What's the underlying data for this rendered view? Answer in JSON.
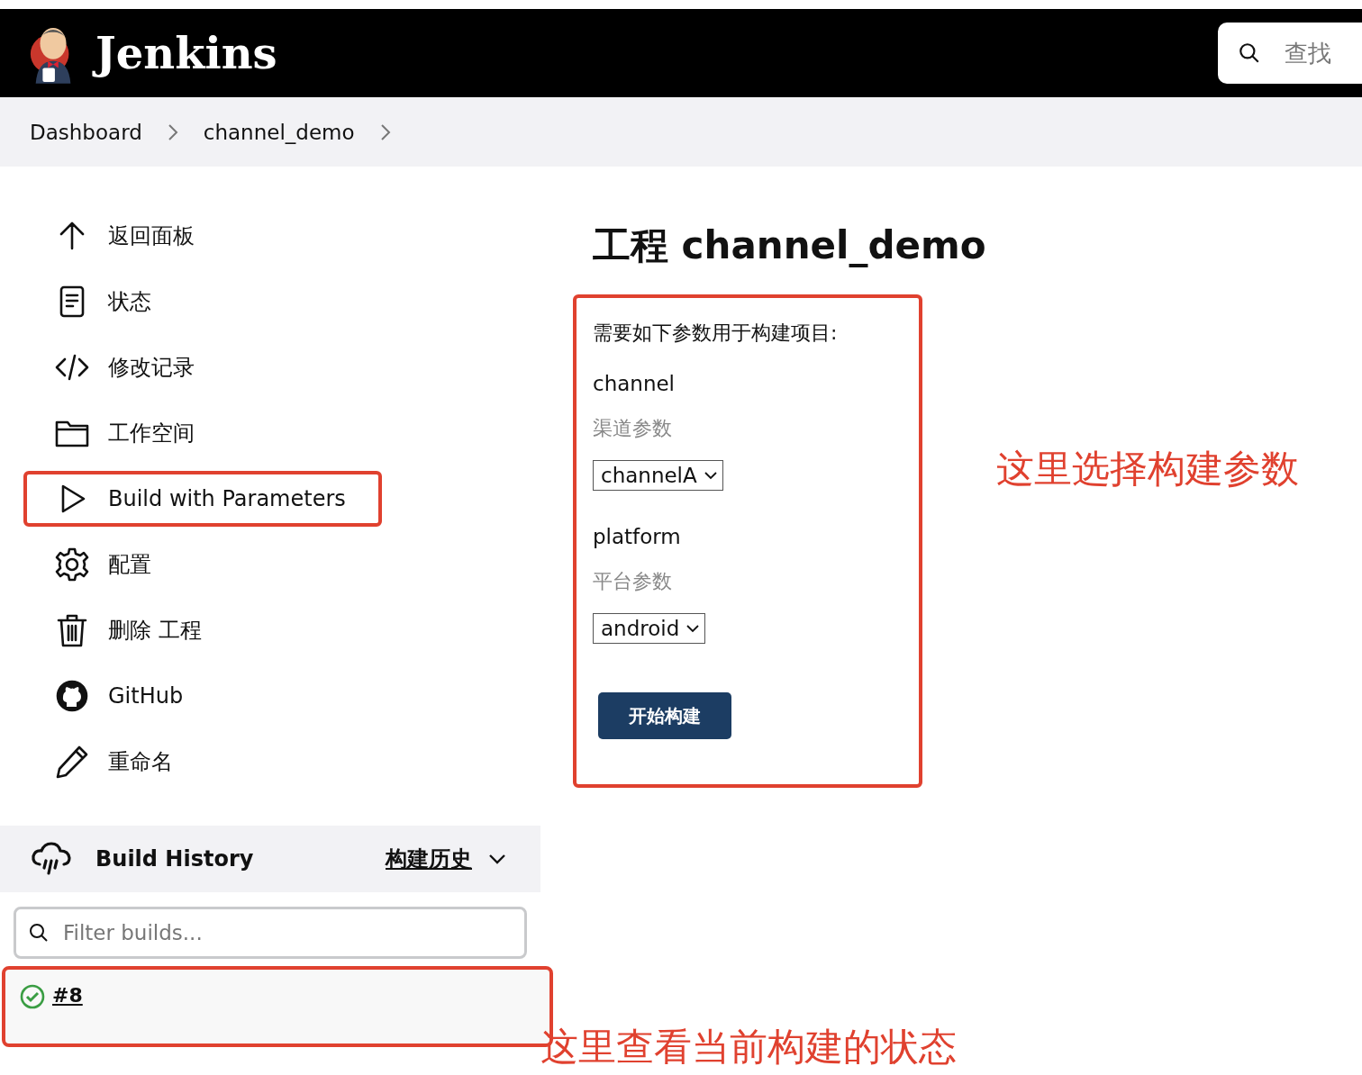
{
  "header": {
    "brand": "Jenkins",
    "search": {
      "placeholder": "查找"
    }
  },
  "breadcrumbs": [
    {
      "label": "Dashboard"
    },
    {
      "label": "channel_demo"
    }
  ],
  "sidebar": {
    "items": [
      {
        "label": "返回面板",
        "highlighted": false
      },
      {
        "label": "状态",
        "highlighted": false
      },
      {
        "label": "修改记录",
        "highlighted": false
      },
      {
        "label": "工作空间",
        "highlighted": false
      },
      {
        "label": "Build with Parameters",
        "highlighted": true
      },
      {
        "label": "配置",
        "highlighted": false
      },
      {
        "label": "删除 工程",
        "highlighted": false
      },
      {
        "label": "GitHub",
        "highlighted": false
      },
      {
        "label": "重命名",
        "highlighted": false
      }
    ]
  },
  "build_history": {
    "title": "Build History",
    "link": "构建历史",
    "filter": {
      "placeholder": "Filter builds..."
    },
    "builds": [
      {
        "number": "#8",
        "highlighted": true
      }
    ]
  },
  "main": {
    "title": "工程 channel_demo",
    "form": {
      "highlighted": true,
      "intro": "需要如下参数用于构建项目:",
      "parameters": [
        {
          "name": "channel",
          "description": "渠道参数",
          "value": "channelA"
        },
        {
          "name": "platform",
          "description": "平台参数",
          "value": "android"
        }
      ],
      "submit": "开始构建"
    }
  },
  "annotations": [
    {
      "text": "这里选择构建参数"
    },
    {
      "text": "这里查看当前构建的状态"
    }
  ]
}
